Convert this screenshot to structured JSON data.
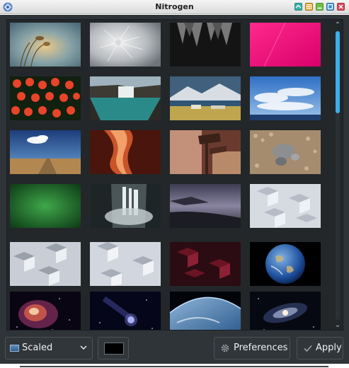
{
  "window": {
    "title": "Nitrogen"
  },
  "titlebar_buttons": [
    "shade",
    "keep-above",
    "minimize",
    "maximize",
    "close"
  ],
  "thumbnails": [
    {
      "name": "thumb-grass-sunset"
    },
    {
      "name": "thumb-dandelion"
    },
    {
      "name": "thumb-dark-leaves"
    },
    {
      "name": "thumb-pink-fabric"
    },
    {
      "name": "thumb-red-flowers"
    },
    {
      "name": "thumb-waterfall-canyon"
    },
    {
      "name": "thumb-mountain-village"
    },
    {
      "name": "thumb-blue-sky-clouds"
    },
    {
      "name": "thumb-desert-road-sky"
    },
    {
      "name": "thumb-antelope-canyon"
    },
    {
      "name": "thumb-wooden-sign"
    },
    {
      "name": "thumb-pebbles"
    },
    {
      "name": "thumb-green-gradient"
    },
    {
      "name": "thumb-misty-waterfall"
    },
    {
      "name": "thumb-dusk-beach"
    },
    {
      "name": "thumb-white-cubes-1"
    },
    {
      "name": "thumb-white-cubes-2"
    },
    {
      "name": "thumb-white-cubes-3"
    },
    {
      "name": "thumb-red-cubes"
    },
    {
      "name": "thumb-earth"
    },
    {
      "name": "thumb-orion-nebula"
    },
    {
      "name": "thumb-comet"
    },
    {
      "name": "thumb-earth-horizon"
    },
    {
      "name": "thumb-galaxy"
    }
  ],
  "controls": {
    "mode_label": "Scaled",
    "preferences_label": "Preferences",
    "apply_label": "Apply",
    "background_color": "#000000"
  },
  "colors": {
    "accent": "#3daee9",
    "panel": "#2f3438"
  }
}
